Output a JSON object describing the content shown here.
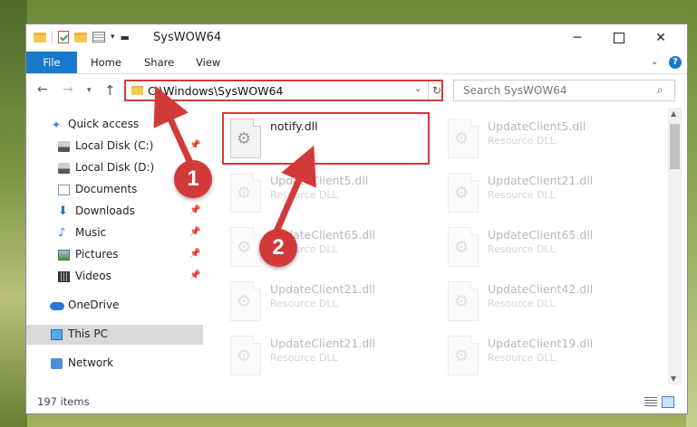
{
  "window": {
    "title": "SysWOW64"
  },
  "ribbon": {
    "tabs": [
      {
        "label": "File"
      },
      {
        "label": "Home"
      },
      {
        "label": "Share"
      },
      {
        "label": "View"
      }
    ],
    "help": "?"
  },
  "navigation": {
    "address": "C:\\Windows\\SysWOW64",
    "search_placeholder": "Search SysWOW64"
  },
  "sidebar": {
    "items": [
      {
        "label": "Quick access",
        "icon": "star-icon"
      },
      {
        "label": "Local Disk (C:)",
        "icon": "disk-icon",
        "pinned": true
      },
      {
        "label": "Local Disk (D:)",
        "icon": "disk-icon"
      },
      {
        "label": "Documents",
        "icon": "documents-icon",
        "pinned": true
      },
      {
        "label": "Downloads",
        "icon": "download-icon",
        "pinned": true
      },
      {
        "label": "Music",
        "icon": "music-icon",
        "pinned": true
      },
      {
        "label": "Pictures",
        "icon": "pictures-icon",
        "pinned": true
      },
      {
        "label": "Videos",
        "icon": "videos-icon",
        "pinned": true
      },
      {
        "label": "OneDrive",
        "icon": "onedrive-icon"
      },
      {
        "label": "This PC",
        "icon": "computer-icon",
        "selected": true
      },
      {
        "label": "Network",
        "icon": "network-icon"
      }
    ]
  },
  "files": [
    {
      "name": "notify.dll",
      "type": ""
    },
    {
      "name": "UpdateClient5.dll",
      "type": "Resource DLL"
    },
    {
      "name": "UpdateClient5.dll",
      "type": "Resource DLL"
    },
    {
      "name": "UpdateClient21.dll",
      "type": "Resource DLL"
    },
    {
      "name": "UpdateClient65.dll",
      "type": "Resource DLL"
    },
    {
      "name": "UpdateClient65.dll",
      "type": "Resource DLL"
    },
    {
      "name": "UpdateClient21.dll",
      "type": "Resource DLL"
    },
    {
      "name": "UpdateClient42.dll",
      "type": "Resource DLL"
    },
    {
      "name": "UpdateClient21.dll",
      "type": "Resource DLL"
    },
    {
      "name": "UpdateClient19.dll",
      "type": "Resource DLL"
    }
  ],
  "status": {
    "item_count": "197 items"
  },
  "annotations": {
    "step1": "1",
    "step2": "2",
    "color": "#d23a3a"
  }
}
